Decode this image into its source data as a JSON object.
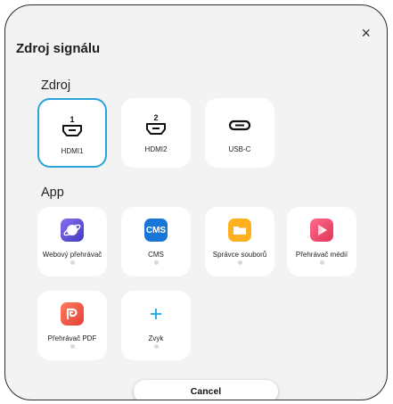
{
  "dialog": {
    "title": "Zdroj signálu",
    "close_label": "×"
  },
  "sources": {
    "heading": "Zdroj",
    "items": [
      {
        "label": "HDMI1",
        "icon": "hdmi-1-icon",
        "selected": true
      },
      {
        "label": "HDMI2",
        "icon": "hdmi-2-icon",
        "selected": false
      },
      {
        "label": "USB-C",
        "icon": "usb-c-icon",
        "selected": false
      }
    ]
  },
  "apps": {
    "heading": "App",
    "items": [
      {
        "label": "Webový přehrávač",
        "icon": "web-player-icon",
        "color": "#6a4fd0"
      },
      {
        "label": "CMS",
        "icon": "cms-icon",
        "color": "#1877d6"
      },
      {
        "label": "Správce souborů",
        "icon": "file-manager-icon",
        "color": "#ffb01f"
      },
      {
        "label": "Přehrávač médií",
        "icon": "media-player-icon",
        "color": "#f0506e"
      },
      {
        "label": "Přehrávač PDF",
        "icon": "pdf-player-icon",
        "color": "#ee4f3a"
      },
      {
        "label": "Zvyk",
        "icon": "add-icon",
        "color": "#1da1e8"
      }
    ]
  },
  "hdmi_numbers": [
    "1",
    "2"
  ],
  "cms_text": "CMS",
  "cancel_label": "Cancel",
  "accent_color": "#2aa3d8"
}
